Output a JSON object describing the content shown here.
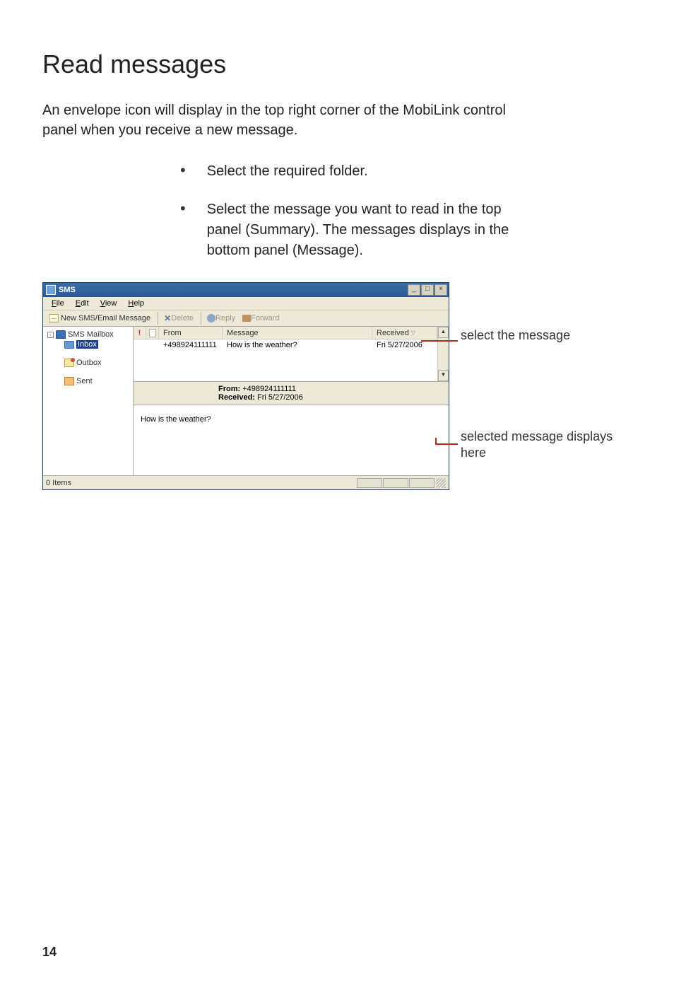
{
  "page": {
    "title": "Read messages",
    "intro": "An envelope icon will display in the top right corner of the MobiLink control panel when you receive a new message.",
    "bullets": [
      "Select the required folder.",
      "Select the message you want to read in the top panel (Summary). The messages displays in the bottom panel (Message)."
    ],
    "number": "14"
  },
  "app": {
    "title": "SMS",
    "win_controls": {
      "min": "_",
      "max": "□",
      "close": "×"
    },
    "menu": {
      "file": "File",
      "edit": "Edit",
      "view": "View",
      "help": "Help"
    },
    "toolbar": {
      "new": "New SMS/Email Message",
      "delete": "Delete",
      "reply": "Reply",
      "forward": "Forward"
    },
    "tree": {
      "root": "SMS Mailbox",
      "inbox": "Inbox",
      "outbox": "Outbox",
      "sent": "Sent"
    },
    "list": {
      "headers": {
        "from": "From",
        "message": "Message",
        "received": "Received"
      },
      "rows": [
        {
          "from": "+498924111111",
          "message": "How is the weather?",
          "received": "Fri 5/27/2006"
        }
      ]
    },
    "preview": {
      "from_label": "From:",
      "from_value": "+498924111111",
      "received_label": "Received:",
      "received_value": "Fri 5/27/2006",
      "body": "How is the weather?"
    },
    "status": {
      "items": "0 Items"
    }
  },
  "callouts": {
    "top": "select the message",
    "bottom": "selected message displays here"
  }
}
